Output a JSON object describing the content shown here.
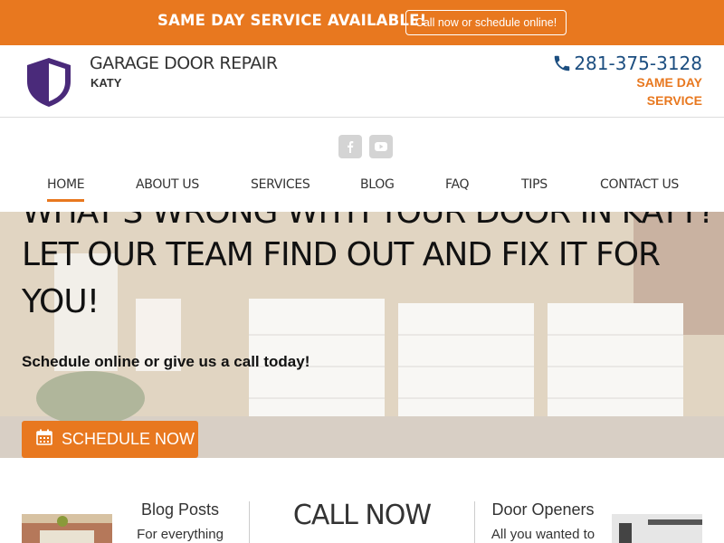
{
  "topbar": {
    "announcement": "SAME DAY SERVICE AVAILABLE!",
    "cta_label": "Call now or schedule online!"
  },
  "header": {
    "brand_title": "GARAGE DOOR REPAIR",
    "brand_subtitle": "KATY",
    "phone": "281-375-3128",
    "service_note": "SAME DAY SERVICE"
  },
  "nav": {
    "social": [
      "facebook-icon",
      "youtube-icon"
    ],
    "items": [
      {
        "label": "HOME",
        "active": true
      },
      {
        "label": "ABOUT US"
      },
      {
        "label": "SERVICES"
      },
      {
        "label": "BLOG"
      },
      {
        "label": "FAQ"
      },
      {
        "label": "TIPS"
      },
      {
        "label": "CONTACT US"
      }
    ]
  },
  "hero": {
    "headline_partial": "WHAT'S WRONG WITH YOUR DOOR IN KATY?",
    "headline_line2": "LET OUR TEAM FIND OUT AND FIX IT FOR",
    "headline_line3": "YOU!",
    "subline": "Schedule online or give us a call today!",
    "button_label": "SCHEDULE NOW"
  },
  "bottom": {
    "left_title": "Blog Posts",
    "left_text": "For everything",
    "center_title": "CALL NOW",
    "right_title": "Door Openers",
    "right_text": "All you wanted to"
  },
  "colors": {
    "accent": "#e8781f",
    "brand_blue": "#1c4e80",
    "logo_purple": "#4a2a7a"
  }
}
